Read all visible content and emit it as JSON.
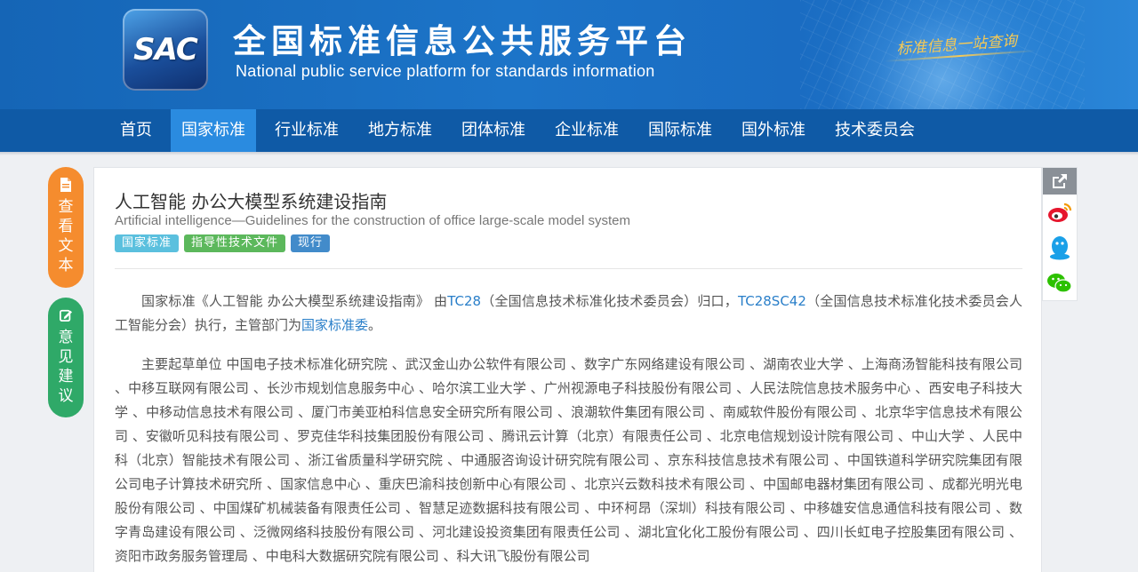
{
  "header": {
    "logo_text": "SAC",
    "title_cn": "全国标准信息公共服务平台",
    "title_en": "National public service platform  for standards information",
    "slogan": "标准信息一站查询"
  },
  "nav": {
    "items": [
      "首页",
      "国家标准",
      "行业标准",
      "地方标准",
      "团体标准",
      "企业标准",
      "国际标准",
      "国外标准",
      "技术委员会"
    ],
    "active": "国家标准"
  },
  "side_buttons": {
    "view_text": "查看文本",
    "feedback": "意见建议"
  },
  "standard": {
    "title_cn": "人工智能 办公大模型系统建设指南",
    "title_en": "Artificial intelligence—Guidelines for the construction of office large-scale model system",
    "tags": [
      "国家标准",
      "指导性技术文件",
      "现行"
    ],
    "para1": {
      "prefix": "国家标准《人工智能 办公大模型系统建设指南》 由",
      "tc": "TC28",
      "mid1": "（全国信息技术标准化技术委员会）归口，",
      "sc": "TC28SC42",
      "mid2": "（全国信息技术标准化技术委员会人工智能分会）执行，主管部门为",
      "authority": "国家标准委",
      "suffix": "。"
    },
    "para2": "主要起草单位 中国电子技术标准化研究院 、武汉金山办公软件有限公司 、数字广东网络建设有限公司 、湖南农业大学 、上海商汤智能科技有限公司 、中移互联网有限公司 、长沙市规划信息服务中心 、哈尔滨工业大学 、广州视源电子科技股份有限公司 、人民法院信息技术服务中心 、西安电子科技大学 、中移动信息技术有限公司 、厦门市美亚柏科信息安全研究所有限公司 、浪潮软件集团有限公司 、南威软件股份有限公司 、北京华宇信息技术有限公司 、安徽听见科技有限公司 、罗克佳华科技集团股份有限公司 、腾讯云计算（北京）有限责任公司 、北京电信规划设计院有限公司 、中山大学 、人民中科（北京）智能技术有限公司 、浙江省质量科学研究院 、中通服咨询设计研究院有限公司 、京东科技信息技术有限公司 、中国铁道科学研究院集团有限公司电子计算技术研究所 、国家信息中心 、重庆巴渝科技创新中心有限公司 、北京兴云数科技术有限公司 、中国邮电器材集团有限公司 、成都光明光电股份有限公司 、中国煤矿机械装备有限责任公司 、智慧足迹数据科技有限公司 、中环柯昂（深圳）科技有限公司 、中移雄安信息通信科技有限公司 、数字青岛建设有限公司 、泛微网络科技股份有限公司 、河北建设投资集团有限责任公司 、湖北宜化化工股份有限公司 、四川长虹电子控股集团有限公司 、资阳市政务服务管理局 、中电科大数据研究院有限公司 、科大讯飞股份有限公司"
  },
  "colors": {
    "banner": "#1c74c8",
    "nav": "#0f5aa6",
    "nav_active": "#2a8be0",
    "view_button": "#f58c2e",
    "feedback_button": "#2fa968",
    "link": "#2a7fc9"
  },
  "icons": {
    "view": "document-icon",
    "feedback": "edit-icon",
    "share": "share-icon",
    "weibo": "weibo-icon",
    "qq": "qq-icon",
    "wechat": "wechat-icon"
  }
}
